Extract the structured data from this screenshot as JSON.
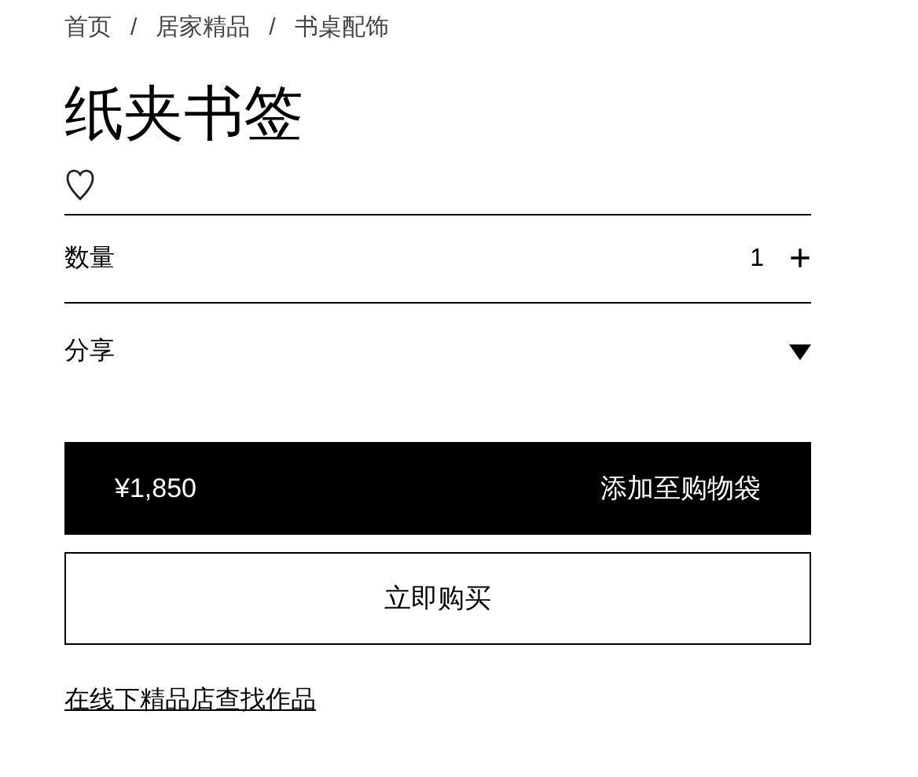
{
  "breadcrumb": [
    "首页",
    "居家精品",
    "书桌配饰"
  ],
  "breadcrumb_separator": "/",
  "product": {
    "title": "纸夹书签"
  },
  "quantity": {
    "label": "数量",
    "value": "1",
    "increment": "+"
  },
  "share": {
    "label": "分享"
  },
  "add_to_bag": {
    "price": "¥1,850",
    "label": "添加至购物袋"
  },
  "buy_now": {
    "label": "立即购买"
  },
  "store_link": "在线下精品店查找作品"
}
